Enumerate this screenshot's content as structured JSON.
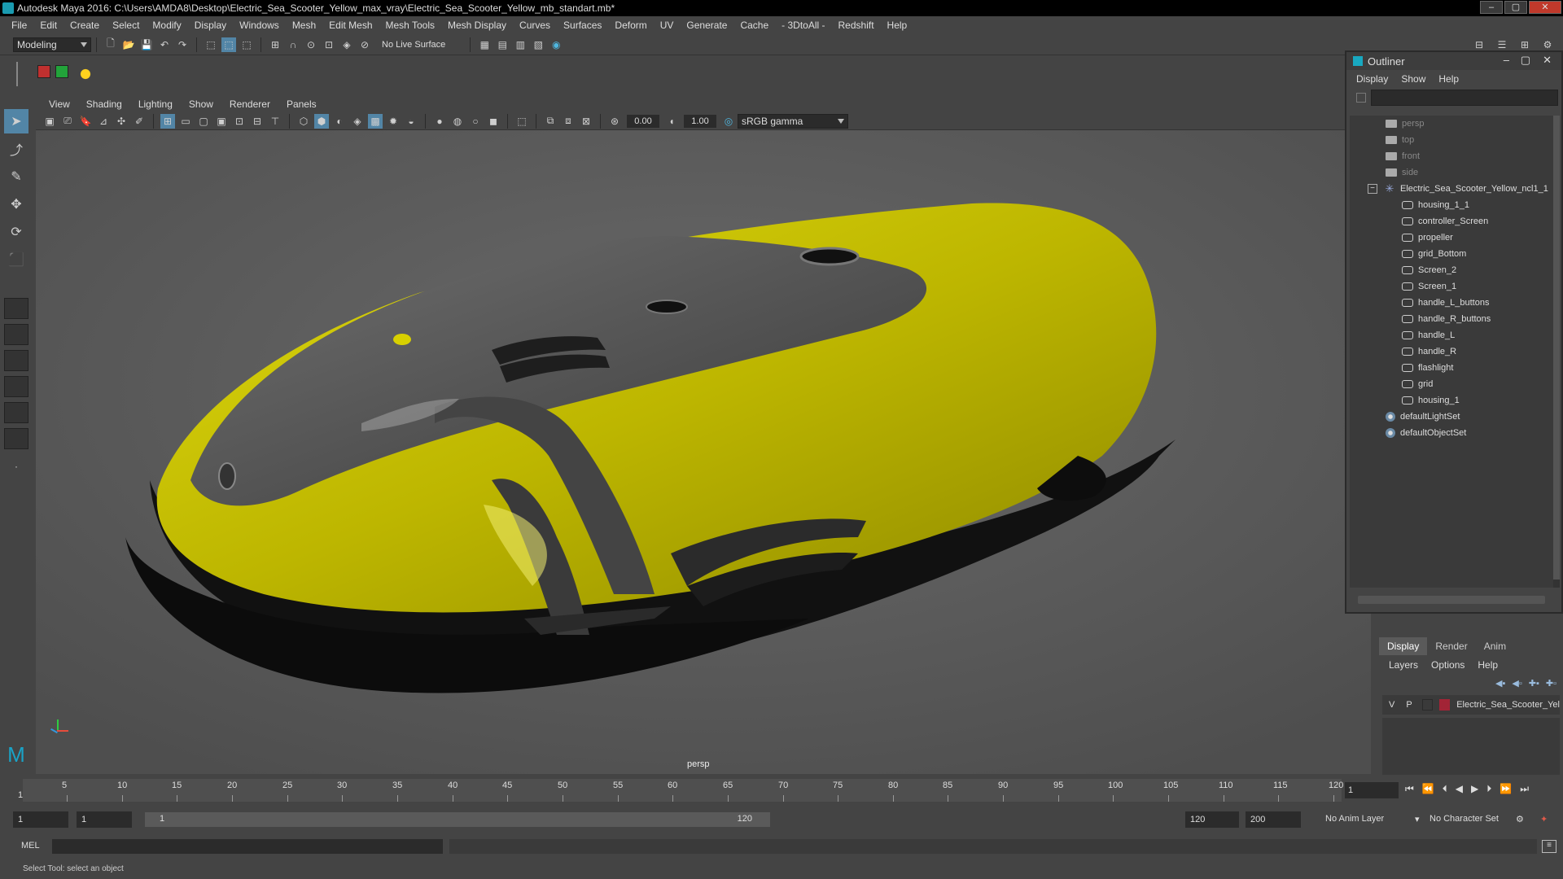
{
  "title_bar": {
    "title": "Autodesk Maya 2016: C:\\Users\\AMDA8\\Desktop\\Electric_Sea_Scooter_Yellow_max_vray\\Electric_Sea_Scooter_Yellow_mb_standart.mb*",
    "minimize": "‒",
    "maximize": "▢",
    "close": "✕"
  },
  "menu_bar": {
    "items": [
      "File",
      "Edit",
      "Create",
      "Select",
      "Modify",
      "Display",
      "Windows",
      "Mesh",
      "Edit Mesh",
      "Mesh Tools",
      "Mesh Display",
      "Curves",
      "Surfaces",
      "Deform",
      "UV",
      "Generate",
      "Cache",
      "- 3DtoAll -",
      "Redshift",
      "Help"
    ]
  },
  "shelf_bar": {
    "mode": "Modeling",
    "live_surface": "No Live Surface"
  },
  "viewport": {
    "menu": [
      "View",
      "Shading",
      "Lighting",
      "Show",
      "Renderer",
      "Panels"
    ],
    "exposure": "0.00",
    "gamma": "1.00",
    "color_space": "sRGB gamma",
    "camera_label": "persp"
  },
  "outliner": {
    "title": "Outliner",
    "menu": [
      "Display",
      "Show",
      "Help"
    ],
    "cameras": [
      "persp",
      "top",
      "front",
      "side"
    ],
    "group": "Electric_Sea_Scooter_Yellow_ncl1_1",
    "children": [
      "housing_1_1",
      "controller_Screen",
      "propeller",
      "grid_Bottom",
      "Screen_2",
      "Screen_1",
      "handle_L_buttons",
      "handle_R_buttons",
      "handle_L",
      "handle_R",
      "flashlight",
      "grid",
      "housing_1"
    ],
    "sets": [
      "defaultLightSet",
      "defaultObjectSet"
    ]
  },
  "layer_panel": {
    "tabs": [
      "Display",
      "Render",
      "Anim"
    ],
    "menu": [
      "Layers",
      "Options",
      "Help"
    ],
    "layer": {
      "v": "V",
      "p": "P",
      "name": "Electric_Sea_Scooter_Yel",
      "color": "#a22436"
    }
  },
  "timeline": {
    "start_label": "1",
    "ticks": [
      "5",
      "10",
      "15",
      "20",
      "25",
      "30",
      "35",
      "40",
      "45",
      "50",
      "55",
      "60",
      "65",
      "70",
      "75",
      "80",
      "85",
      "90",
      "95",
      "100",
      "105",
      "110",
      "115",
      "120"
    ],
    "current_frame": "1",
    "controls": [
      "⏮",
      "⏪",
      "⏴",
      "◀",
      "▶",
      "⏵",
      "⏩",
      "⏭"
    ]
  },
  "range_bar": {
    "start": "1",
    "playback_start": "1",
    "slider_start": "1",
    "slider_end": "120",
    "playback_end": "120",
    "end": "200",
    "anim_layer": "No Anim Layer",
    "character_set": "No Character Set"
  },
  "command_line": {
    "label": "MEL"
  },
  "help_line": {
    "text": "Select Tool: select an object"
  },
  "colors": {
    "accent": "#5285a6",
    "scooter_yellow": "#c8c200",
    "scooter_dark": "#3a3a3a"
  }
}
